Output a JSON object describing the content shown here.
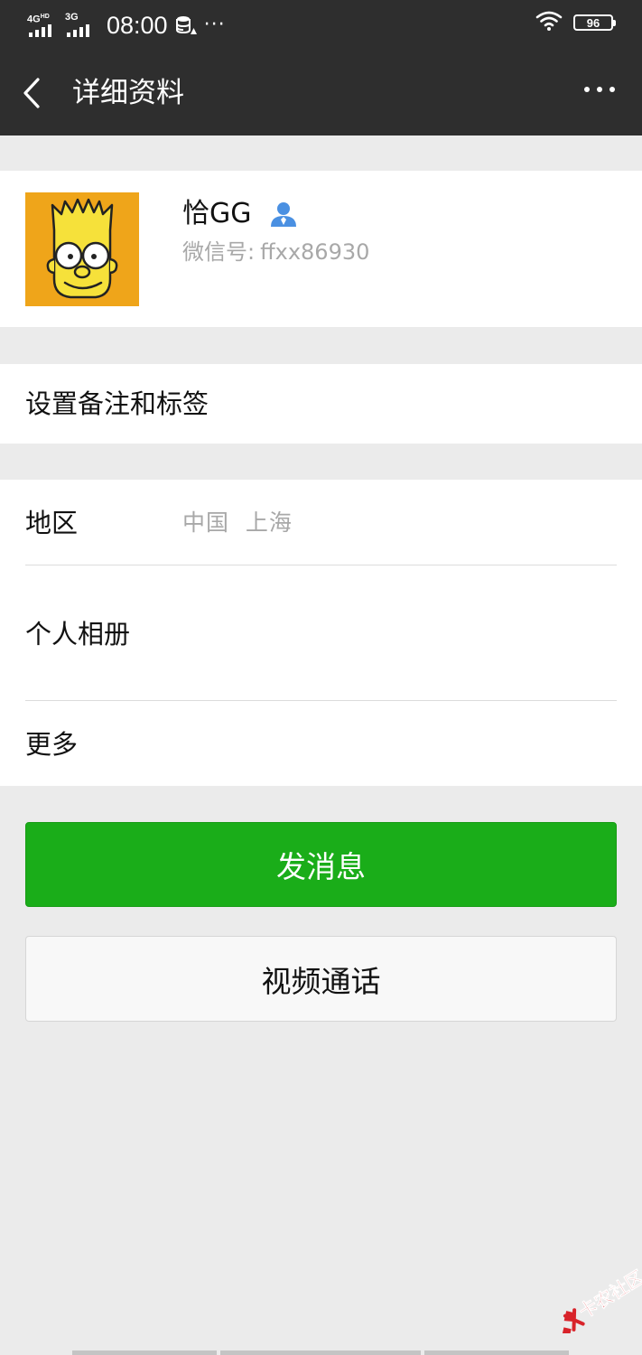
{
  "status_bar": {
    "sim1_label": "4G",
    "sim1_sup": "HD",
    "sim2_label": "3G",
    "time": "08:00",
    "overflow": "···",
    "battery": "96"
  },
  "nav": {
    "title": "详细资料"
  },
  "profile": {
    "name": "恰GG",
    "wechat_id_label": "微信号:",
    "wechat_id": "ffxx86930"
  },
  "rows": {
    "remark_label": "设置备注和标签",
    "region_label": "地区",
    "region_value": "中国  上海",
    "album_label": "个人相册",
    "more_label": "更多"
  },
  "buttons": {
    "send_message": "发消息",
    "video_call": "视频通话"
  },
  "watermark": {
    "text": "卡农社区"
  },
  "colors": {
    "header_bg": "#2e2e2e",
    "page_bg": "#ebebeb",
    "primary_green": "#1aad19",
    "secondary_text": "#a8a8a8",
    "contact_icon": "#4a90e2"
  }
}
